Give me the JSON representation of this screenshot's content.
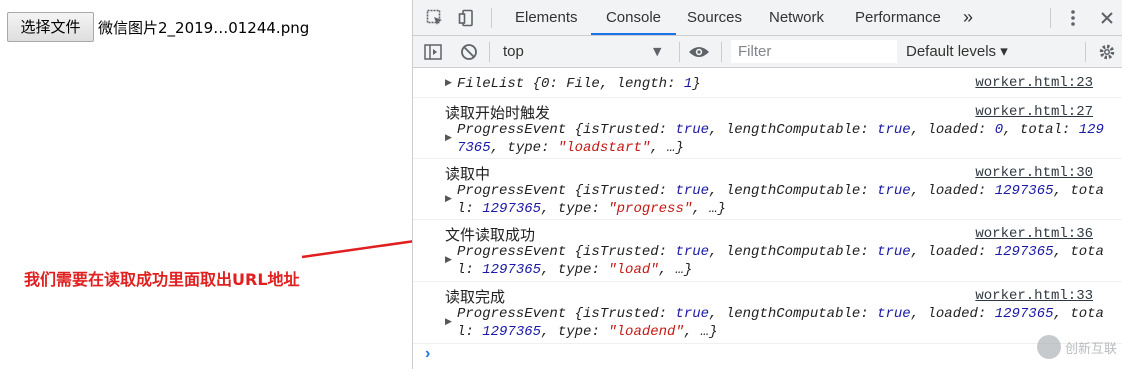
{
  "page": {
    "file_button_label": "选择文件",
    "file_name": "微信图片2_2019…01244.png",
    "annotation": "我们需要在读取成功里面取出URL地址"
  },
  "devtools": {
    "tabs": [
      "Elements",
      "Console",
      "Sources",
      "Network",
      "Performance"
    ],
    "active_tab": "Console",
    "more_tabs_glyph": "»",
    "context": "top",
    "filter_placeholder": "Filter",
    "levels": "Default levels ▾",
    "messages": [
      {
        "source": "worker.html:23",
        "line1": "FileList {0: File, length: 1}"
      },
      {
        "label": "读取开始时触发",
        "source": "worker.html:27",
        "line1": "ProgressEvent {isTrusted: true, lengthComputable: true, loaded: 0, total: 129",
        "line2": "7365, type: \"loadstart\", …}"
      },
      {
        "label": "读取中",
        "source": "worker.html:30",
        "line1": "ProgressEvent {isTrusted: true, lengthComputable: true, loaded: 1297365, tota",
        "line2": "l: 1297365, type: \"progress\", …}"
      },
      {
        "label": "文件读取成功",
        "source": "worker.html:36",
        "line1": "ProgressEvent {isTrusted: true, lengthComputable: true, loaded: 1297365, tota",
        "line2": "l: 1297365, type: \"load\", …}"
      },
      {
        "label": "读取完成",
        "source": "worker.html:33",
        "line1": "ProgressEvent {isTrusted: true, lengthComputable: true, loaded: 1297365, tota",
        "line2": "l: 1297365, type: \"loadend\", …}"
      }
    ],
    "prompt": "›"
  },
  "watermark": "创新互联",
  "colors": {
    "accent": "#1a73e8",
    "annotation": "#e02020"
  }
}
